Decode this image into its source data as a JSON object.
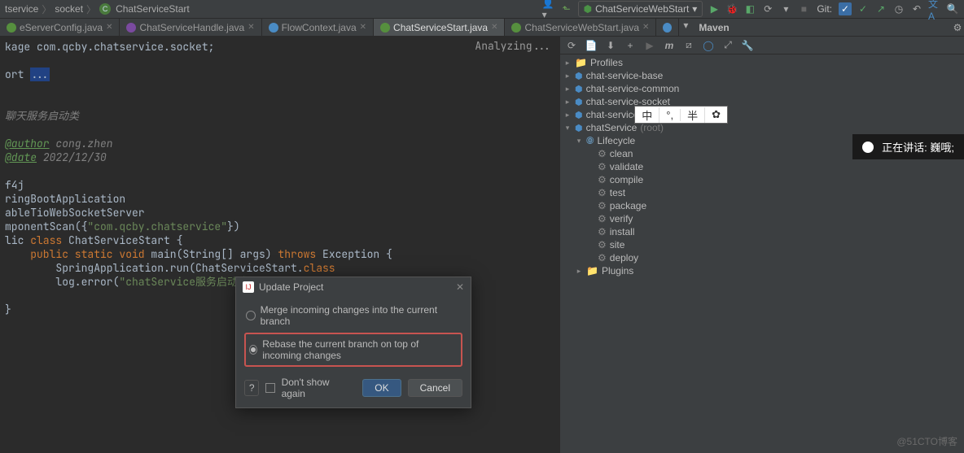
{
  "breadcrumb": [
    "tservice",
    "socket",
    "ChatServiceStart"
  ],
  "run_config": "ChatServiceWebStart",
  "git_label": "Git:",
  "tabs": [
    {
      "name": "eServerConfig.java"
    },
    {
      "name": "ChatServiceHandle.java"
    },
    {
      "name": "FlowContext.java"
    },
    {
      "name": "ChatServiceStart.java",
      "active": true
    },
    {
      "name": "ChatServiceWebStart.java"
    }
  ],
  "editor_status": "Analyzing...",
  "code": {
    "line1_pre": "kage ",
    "line1_pkg": "com.qcby.chatservice.socket",
    "line1_semi": ";",
    "line2_pre": "ort ",
    "line2_sel": "...",
    "comment1": "聊天服务启动类",
    "author_tag": "@author",
    "author_val": " cong.zhen",
    "date_tag": "@date",
    "date_val": " 2022/12/30",
    "anno1": "f4j",
    "anno2": "ringBootApplication",
    "anno3": "ableTioWebSocketServer",
    "anno4_pre": "mponentScan({",
    "anno4_str": "\"com.qcby.chatservice\"",
    "anno4_post": "})",
    "classdecl_pre": "lic ",
    "classdecl_kw": "class ",
    "classdecl_name": "ChatServiceStart {",
    "main_pre": "    ",
    "main_mods": "public static void ",
    "main_sig": "main(String[] args) ",
    "main_throws": "throws ",
    "main_exc": "Exception {",
    "run_line": "        SpringApplication.run(ChatServiceStart.",
    "run_kw": "class",
    "log_pre": "        log.error(",
    "log_str": "\"chatService服务启动成功-------------------\"",
    "close": "}"
  },
  "maven": {
    "title": "Maven",
    "profiles": "Profiles",
    "modules": [
      "chat-service-base",
      "chat-service-common",
      "chat-service-socket",
      "chat-service-web"
    ],
    "root_module": "chatService",
    "root_suffix": "(root)",
    "lifecycle_label": "Lifecycle",
    "lifecycle": [
      "clean",
      "validate",
      "compile",
      "test",
      "package",
      "verify",
      "install",
      "site",
      "deploy"
    ],
    "plugins": "Plugins"
  },
  "ime": [
    "中",
    "°,",
    "半",
    "✿"
  ],
  "voice": "正在讲话: 巍哦;",
  "dialog": {
    "title": "Update Project",
    "option1": "Merge incoming changes into the current branch",
    "option2": "Rebase the current branch on top of incoming changes",
    "dont_show": "Don't show again",
    "ok": "OK",
    "cancel": "Cancel"
  },
  "watermark": "@51CTO博客"
}
